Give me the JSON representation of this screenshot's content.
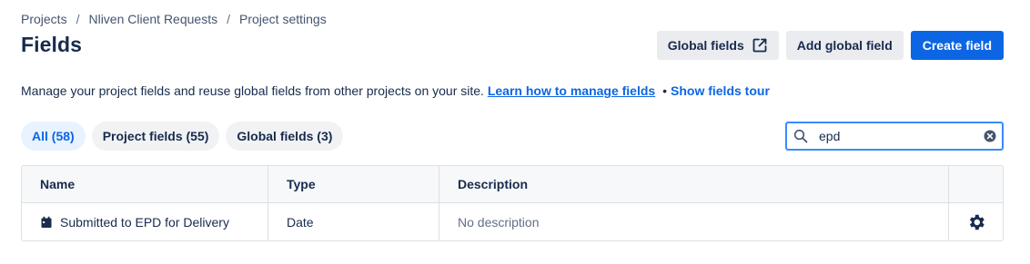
{
  "breadcrumb": {
    "items": [
      "Projects",
      "Nliven Client Requests",
      "Project settings"
    ],
    "separator": "/"
  },
  "page": {
    "title": "Fields"
  },
  "actions": {
    "global_fields": "Global fields",
    "add_global_field": "Add global field",
    "create_field": "Create field"
  },
  "description": {
    "text": "Manage your project fields and reuse global fields from other projects on your site.",
    "learn_link": "Learn how to manage fields",
    "bullet": "•",
    "tour_link": "Show fields tour"
  },
  "filters": [
    {
      "label": "All (58)",
      "active": true
    },
    {
      "label": "Project fields (55)",
      "active": false
    },
    {
      "label": "Global fields (3)",
      "active": false
    }
  ],
  "search": {
    "value": "epd",
    "placeholder": ""
  },
  "table": {
    "columns": [
      "Name",
      "Type",
      "Description",
      ""
    ],
    "rows": [
      {
        "name": "Submitted to EPD for Delivery",
        "icon": "calendar-icon",
        "type": "Date",
        "description": "No description"
      }
    ]
  },
  "colors": {
    "primary": "#0c66e4",
    "focus": "#388bff",
    "text": "#172b4d",
    "subtle_bg": "#ebecf0",
    "active_pill_bg": "#e9f2ff"
  }
}
